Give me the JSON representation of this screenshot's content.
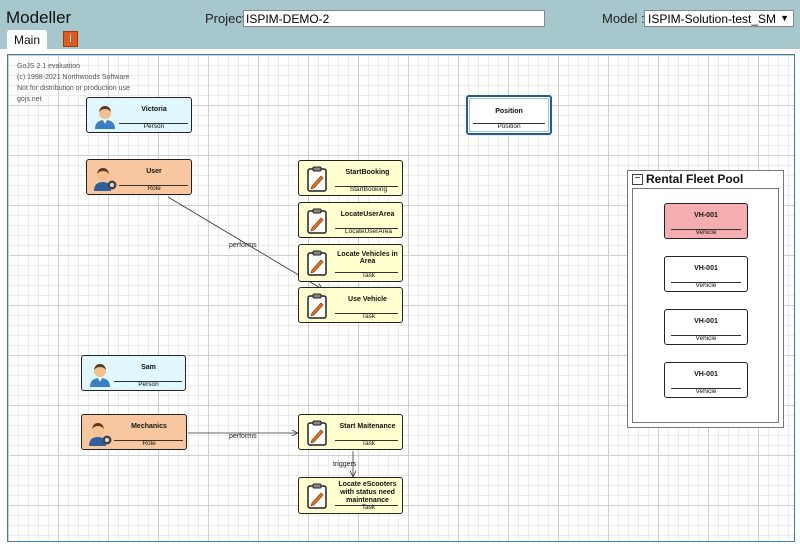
{
  "app": {
    "title": "Modeller",
    "project_label": "Project :",
    "project_value": "ISPIM-DEMO-2",
    "model_label": "Model :",
    "model_value": "ISPIM-Solution-test_SM"
  },
  "tabs": [
    {
      "label": "Main"
    }
  ],
  "info_button": {
    "label": "i"
  },
  "watermark": [
    "GoJS 2.1 evaluation",
    "(c) 1998-2021 Northwoods Software",
    "Not for distribution or production use",
    "gojs.net"
  ],
  "nodes": {
    "victoria": {
      "name": "Victoria",
      "kind": "Person"
    },
    "position": {
      "name": "Position",
      "kind": "Position"
    },
    "user": {
      "name": "User",
      "kind": "Role"
    },
    "start_booking": {
      "name": "StartBooking",
      "kind": "StartBooking"
    },
    "locate_user_area": {
      "name": "LocateUserArea",
      "kind": "LocateUserArea"
    },
    "locate_vehicles": {
      "name": "Locate Vehicles in Area",
      "kind": "Task"
    },
    "use_vehicle": {
      "name": "Use Vehicle",
      "kind": "Task"
    },
    "sam": {
      "name": "Sam",
      "kind": "Person"
    },
    "mechanics": {
      "name": "Mechanics",
      "kind": "Role"
    },
    "start_maintenance": {
      "name": "Start Maitenance",
      "kind": "Task"
    },
    "locate_escooters": {
      "name": "Locate eScooters with status need maintenance",
      "kind": "Task"
    }
  },
  "group": {
    "title": "Rental Fleet Pool",
    "collapse_symbol": "−",
    "vehicles": [
      {
        "name": "VH-001",
        "kind": "Vehicle"
      },
      {
        "name": "VH-001",
        "kind": "Vehicle"
      },
      {
        "name": "VH-001",
        "kind": "Vehicle"
      },
      {
        "name": "VH-001",
        "kind": "Vehicle"
      }
    ]
  },
  "links": {
    "user_performs": "performs",
    "mechanics_performs": "performs",
    "triggers": "triggers"
  },
  "colors": {
    "header": "#a6c8cc",
    "person": "#dff7fd",
    "role": "#f8c79f",
    "task": "#ffffd0",
    "vehicle_selected": "#f4aeb0",
    "info_button": "#e05a1c"
  }
}
